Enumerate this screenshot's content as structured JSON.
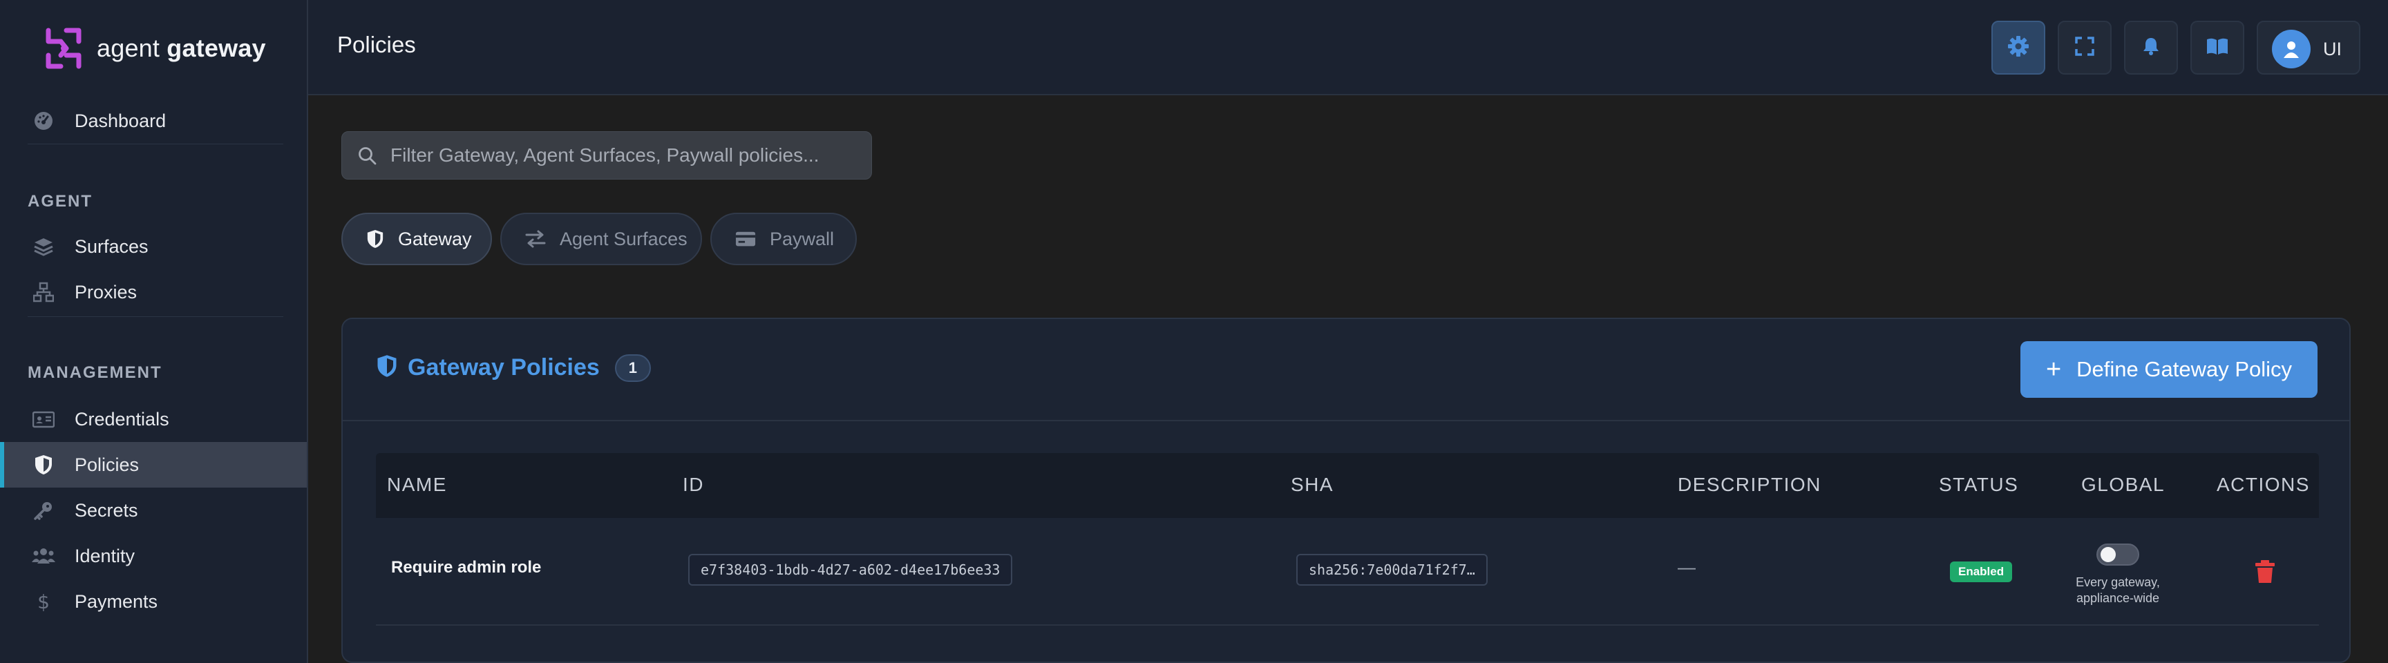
{
  "brand": {
    "name_light": "agent ",
    "name_bold": "gateway"
  },
  "sidebar": {
    "top_items": [
      {
        "label": "Dashboard",
        "icon": "gauge-icon"
      }
    ],
    "sections": [
      {
        "title": "AGENT",
        "items": [
          {
            "label": "Surfaces",
            "icon": "layers-icon"
          },
          {
            "label": "Proxies",
            "icon": "network-icon"
          }
        ]
      },
      {
        "title": "MANAGEMENT",
        "items": [
          {
            "label": "Credentials",
            "icon": "id-card-icon"
          },
          {
            "label": "Policies",
            "icon": "shield-icon",
            "active": true
          },
          {
            "label": "Secrets",
            "icon": "key-icon"
          },
          {
            "label": "Identity",
            "icon": "users-icon"
          },
          {
            "label": "Payments",
            "icon": "dollar-icon"
          }
        ]
      }
    ]
  },
  "header": {
    "title": "Policies",
    "buttons": [
      "settings-icon",
      "fullscreen-icon",
      "bell-icon",
      "book-icon"
    ],
    "user_initials": "UI"
  },
  "search": {
    "placeholder": "Filter Gateway, Agent Surfaces, Paywall policies..."
  },
  "tabs": [
    {
      "label": "Gateway",
      "icon": "shield-icon",
      "active": true
    },
    {
      "label": "Agent Surfaces",
      "icon": "swap-icon"
    },
    {
      "label": "Paywall",
      "icon": "credit-card-icon"
    }
  ],
  "card": {
    "title": "Gateway Policies",
    "count": "1",
    "primary_button": {
      "plus": "+",
      "label": "Define Gateway Policy"
    }
  },
  "table": {
    "columns": [
      "NAME",
      "ID",
      "SHA",
      "DESCRIPTION",
      "STATUS",
      "GLOBAL",
      "ACTIONS"
    ],
    "rows": [
      {
        "name": "Require admin role",
        "id": "e7f38403-1bdb-4d27-a602-d4ee17b6ee33",
        "sha": "sha256:7e00da71f2f7…",
        "description": "—",
        "status": "Enabled",
        "global_on": false,
        "global_hint": "Every gateway, appliance-wide"
      }
    ]
  },
  "colors": {
    "accent": "#4a8fdd",
    "active_nav_bar": "#27a6c9",
    "status_enabled": "#1fa96b",
    "delete": "#e53e3e",
    "logo": "#c04ddd"
  }
}
